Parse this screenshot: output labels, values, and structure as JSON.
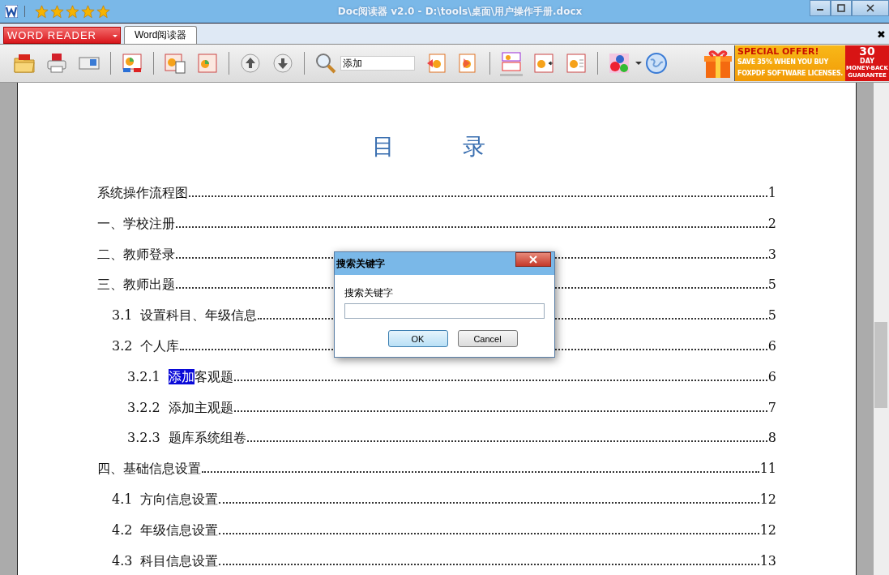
{
  "window": {
    "title": "Doc阅读器 v2.0 - D:\\tools\\桌面\\用户操作手册.docx",
    "rating": {
      "stars": 5
    }
  },
  "app_menu": {
    "label": "WORD READER"
  },
  "tabs": [
    {
      "label": "Word阅读器",
      "selected": true
    }
  ],
  "close_tab": {
    "label": "✖"
  },
  "search": {
    "value": "添加"
  },
  "ad": {
    "headline": "SPECIAL OFFER!",
    "line1": "SAVE 35% WHEN YOU BUY",
    "line2": "FOXPDF SOFTWARE LICENSES.",
    "days": "30",
    "day_label": "DAY",
    "guarantee": "MONEY-BACK GUARANTEE"
  },
  "document": {
    "heading": "目　　　录",
    "toc": [
      {
        "title": "系统操作流程图",
        "page": "1"
      },
      {
        "title": "一、学校注册",
        "page": "2"
      },
      {
        "title": "二、教师登录",
        "page": "3"
      },
      {
        "title": "三、教师出题",
        "page": "5",
        "children": [
          {
            "number": "3.1",
            "title": "设置科目、年级信息",
            "page": "5"
          },
          {
            "number": "3.2",
            "title": "个人库",
            "page": "6",
            "children": [
              {
                "number": "3.2.1",
                "match": "添加",
                "title": "客观题",
                "page": "6"
              },
              {
                "number": "3.2.2",
                "title": "添加主观题",
                "page": "7"
              },
              {
                "number": "3.2.3",
                "title": "题库系统组卷",
                "page": "8"
              }
            ]
          }
        ]
      },
      {
        "title": "四、基础信息设置",
        "page": "11",
        "children": [
          {
            "number": "4.1",
            "title": "方向信息设置",
            "page": "12"
          },
          {
            "number": "4.2",
            "title": "年级信息设置",
            "page": "12"
          },
          {
            "number": "4.3",
            "title": "科目信息设置",
            "page": "13"
          }
        ]
      }
    ]
  },
  "dialog": {
    "title": "搜索关键字",
    "label": "搜索关键字",
    "buttons": [
      {
        "label": "OK",
        "kind": "default"
      },
      {
        "label": "Cancel",
        "kind": "normal"
      }
    ]
  }
}
